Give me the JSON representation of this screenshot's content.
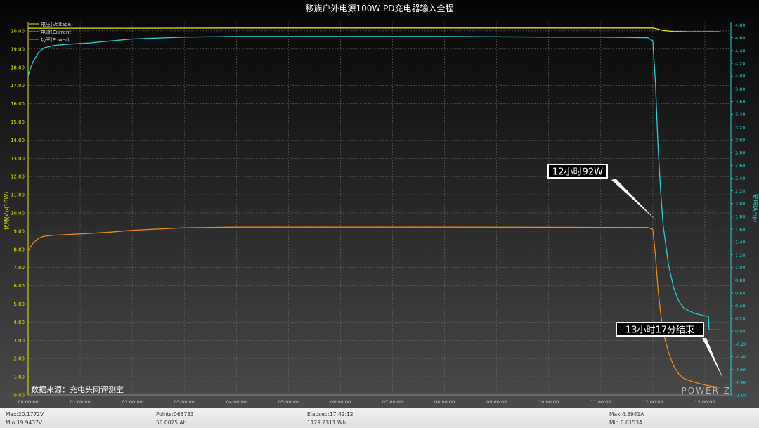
{
  "window": {
    "title": "移族户外电源100W PD充电器输入全程"
  },
  "colors": {
    "voltage": "#e6e600",
    "current": "#21d2d6",
    "power": "#f08a10",
    "grid": "#6a6a6a"
  },
  "chart_data": {
    "type": "line",
    "title": "移族户外电源100W PD充电器输入全程",
    "ylabel_left": "伏特(V)/(10W)",
    "ylabel_right": "安培(Amp)",
    "xlim": [
      0,
      13.5
    ],
    "ylim_left": [
      0,
      20.5
    ],
    "ylim_right": [
      -1.0,
      4.85
    ],
    "x_ticks": [
      "00:00:00",
      "01:00:00",
      "02:00:00",
      "03:00:00",
      "04:00:00",
      "05:00:00",
      "06:00:00",
      "07:00:00",
      "08:00:00",
      "09:00:00",
      "10:00:00",
      "11:00:00",
      "12:00:00",
      "13:00:00"
    ],
    "y_left_ticks": [
      "0.00",
      "1.00",
      "2.00",
      "3.00",
      "4.00",
      "5.00",
      "6.00",
      "7.00",
      "8.00",
      "9.00",
      "10.00",
      "11.00",
      "12.00",
      "13.00",
      "14.00",
      "15.00",
      "16.00",
      "17.00",
      "18.00",
      "19.00",
      "20.00"
    ],
    "y_right_ticks": [
      "-1.00",
      "-0.80",
      "-0.60",
      "-0.40",
      "-0.20",
      "0.00",
      "0.20",
      "0.40",
      "0.60",
      "0.80",
      "1.00",
      "1.20",
      "1.40",
      "1.60",
      "1.80",
      "2.00",
      "2.20",
      "2.40",
      "2.60",
      "2.80",
      "3.00",
      "3.20",
      "3.40",
      "3.60",
      "3.80",
      "4.00",
      "4.20",
      "4.40",
      "4.60",
      "4.80"
    ],
    "grid": true,
    "legend_position": "top-left",
    "series": [
      {
        "name": "电压(Voltage)",
        "axis": "left",
        "x": [
          0,
          0.5,
          1,
          2,
          4,
          6,
          8,
          10,
          11.5,
          12.0,
          12.1,
          12.2,
          12.4,
          12.7,
          13.0,
          13.3
        ],
        "y": [
          20.15,
          20.15,
          20.15,
          20.15,
          20.16,
          20.16,
          20.16,
          20.16,
          20.16,
          20.16,
          20.1,
          20.02,
          19.97,
          19.95,
          19.95,
          19.95
        ]
      },
      {
        "name": "电流(Current)",
        "axis": "right",
        "x": [
          0,
          0.05,
          0.1,
          0.2,
          0.3,
          0.5,
          0.8,
          1.2,
          1.6,
          2.0,
          3.0,
          4.0,
          5.0,
          6.0,
          8.0,
          10.0,
          11.0,
          11.9,
          12.0,
          12.05,
          12.1,
          12.15,
          12.2,
          12.3,
          12.4,
          12.5,
          12.6,
          12.8,
          13.0,
          13.07,
          13.08,
          13.3
        ],
        "y": [
          4.0,
          4.13,
          4.23,
          4.37,
          4.44,
          4.48,
          4.5,
          4.52,
          4.55,
          4.58,
          4.61,
          4.62,
          4.62,
          4.62,
          4.62,
          4.61,
          4.61,
          4.6,
          4.55,
          3.9,
          2.9,
          2.2,
          1.65,
          1.05,
          0.68,
          0.47,
          0.36,
          0.28,
          0.24,
          0.23,
          0.02,
          0.02
        ]
      },
      {
        "name": "功率(Power)",
        "axis": "left",
        "x": [
          0,
          0.05,
          0.1,
          0.2,
          0.3,
          0.5,
          0.8,
          1.2,
          1.6,
          2.0,
          3.0,
          4.0,
          5.0,
          6.0,
          8.0,
          10.0,
          11.0,
          11.9,
          12.0,
          12.05,
          12.1,
          12.15,
          12.2,
          12.3,
          12.4,
          12.5,
          12.6,
          12.8,
          13.0,
          13.2,
          13.3
        ],
        "y": [
          7.9,
          8.15,
          8.35,
          8.6,
          8.72,
          8.78,
          8.82,
          8.88,
          8.95,
          9.05,
          9.18,
          9.22,
          9.22,
          9.22,
          9.22,
          9.21,
          9.2,
          9.2,
          9.1,
          7.7,
          5.8,
          4.5,
          3.45,
          2.35,
          1.6,
          1.15,
          0.9,
          0.7,
          0.55,
          0.45,
          0.42
        ]
      }
    ],
    "annotations": [
      {
        "text": "12小时92W",
        "x": 11.97,
        "y": 9.2
      },
      {
        "text": "13小时17分结束",
        "x": 13.28,
        "y": 0.42
      }
    ]
  },
  "source_label": "数据来源：充电头网评测室",
  "logo_text": "POWER-Z",
  "stats": {
    "max_v": "Max:20.1772V",
    "min_v": "Min:19.9437V",
    "points": "Points:063733",
    "ah": "56.0025 Ah",
    "elapsed": "Elapsed:17:42:12",
    "wh": "1129.2311 Wh",
    "max_a": "Max:4.5941A",
    "min_a": "Min:0.0153A"
  }
}
